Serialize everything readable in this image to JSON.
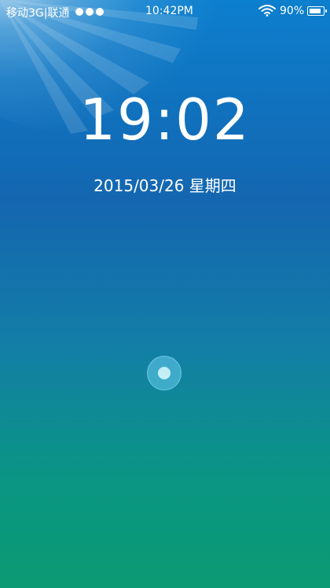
{
  "status_bar": {
    "carrier": "移动3G|联通",
    "signal_strength": 3,
    "time": "10:42PM",
    "wifi_icon": "wifi-icon",
    "battery_percent": "90%",
    "battery_level": 0.9,
    "battery_icon": "battery-icon"
  },
  "lockscreen": {
    "clock": "19:02",
    "date": "2015/03/26 星期四",
    "unlock_icon": "unlock-handle-icon"
  },
  "colors": {
    "top_blue": "#0c7fce",
    "mid_blue": "#1466b0",
    "bottom_green": "#0b9a73"
  }
}
